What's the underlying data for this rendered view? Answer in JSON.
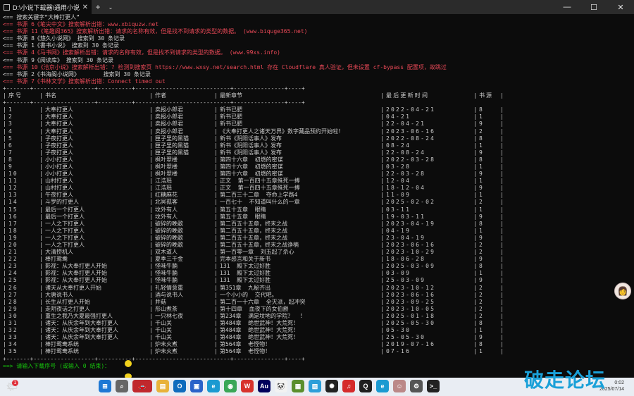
{
  "window": {
    "tab_title": "D:\\小说下载器\\通用小说下载器.exe",
    "tab_close": "✕",
    "new_tab": "+",
    "dropdown": "⌄",
    "minimize": "—",
    "maximize": "☐",
    "close": "✕"
  },
  "messages": [
    {
      "text": "<== 搜索关键字“大棒打更人”",
      "color": "white"
    },
    {
      "text": "<== 书源 6《笔尖中文》搜索解析出错：www.xbiquzw.net",
      "color": "red"
    },
    {
      "text": "<== 书源 11《笔趣阁365》搜索解析出错：请求的名称有效，但是找不到请求的类型的数据。 (www.biquge365.net)",
      "color": "red"
    },
    {
      "text": "<== 书源 8《悠久小说网》 搜索到 30 条记录",
      "color": "white"
    },
    {
      "text": "<== 书源 1《書书小说》 搜索到 30 条记录",
      "color": "white"
    },
    {
      "text": "<== 书源 4《马书网》搜索解析出错：请求的名称有效，但是找不到请求的类型的数据。 (www.99xs.info)",
      "color": "red"
    },
    {
      "text": "<== 书源 9《阅读库》 搜索到 30 条记录",
      "color": "white"
    },
    {
      "text": "<== 书源 10《洽京小说》搜索解析出错：? 检测到搜索页 https://www.wxsy.net/search.html 存在 Cloudflare 真人验证，但未设置 cf-bypass 配置项，故跳过",
      "color": "red"
    },
    {
      "text": "<== 书源 2《书海阁小说网》       搜索到 30 条记录",
      "color": "white"
    },
    {
      "text": "<== 书源 7《书林文学》搜索解析出错：Connect timed out",
      "color": "red"
    }
  ],
  "table": {
    "border": "+-------+------------------+----------+----------------------------+---------------+----+",
    "headers": [
      "序号",
      "书名",
      "作者",
      "最新章节",
      "最后更新时间",
      "书源"
    ],
    "rows": [
      [
        "1",
        "大奉打更人",
        "卖报小郎君",
        "新书已肥",
        "2022-04-21",
        "8"
      ],
      [
        "2",
        "大奉打更人",
        "卖报小郎君",
        "新书已肥",
        "04-21",
        "1"
      ],
      [
        "3",
        "大奉打更人",
        "卖报小郎君",
        "新书已肥",
        "22-04-21",
        "9"
      ],
      [
        "4",
        "大奉打更人",
        "卖报小郎君",
        "《大奉打更人之诸天万界》数字藏品预约开始啦！",
        "2023-06-16",
        "2"
      ],
      [
        "5",
        "子夜打更人",
        "匣子里的黑猫",
        "新书《阴阳话事人》发布",
        "2022-08-24",
        "8"
      ],
      [
        "6",
        "子夜打更人",
        "匣子里的黑猫",
        "新书《阴阳话事人》发布",
        "08-24",
        "1"
      ],
      [
        "7",
        "子夜打更人",
        "匣子里的黑猫",
        "新书《阴阳话事人》发布",
        "22-08-24",
        "9"
      ],
      [
        "8",
        "小小打更人",
        "枫叶翠楼",
        "第四十六章  初燃的密谋",
        "2022-03-28",
        "8"
      ],
      [
        "9",
        "小小打更人",
        "枫叶翠楼",
        "第四十六章  初燃的密谋",
        "03-28",
        "1"
      ],
      [
        "10",
        "小小打更人",
        "枫叶翠楼",
        "第四十六章  初燃的密谋",
        "22-03-28",
        "9"
      ],
      [
        "11",
        "山村打更人",
        "江浩瑶",
        "正文  第一百四十五章殊死一搏",
        "12-04",
        "1"
      ],
      [
        "12",
        "山村打更人",
        "江浩瑶",
        "正文  第一百四十五章殊死一搏",
        "18-12-04",
        "9"
      ],
      [
        "13",
        "午夜打更人",
        "红糖麻花",
        "第二百三十二章  夺命上学路4",
        "11-09",
        "1"
      ],
      [
        "14",
        "斗罗的打更人",
        "北冥孤客",
        "一百七十  不知道叫什么的一章",
        "2025-02-02",
        "2"
      ],
      [
        "15",
        "最后一个打更人",
        "坟外有人",
        "第五十五章  眼睛",
        "03-11",
        "1"
      ],
      [
        "16",
        "最后一个打更人",
        "坟外有人",
        "第五十五章  眼睛",
        "19-03-11",
        "9"
      ],
      [
        "17",
        "一人之下打更人",
        "破碎的晚歌",
        "第二百五十五章，终末之战",
        "2023-04-19",
        "8"
      ],
      [
        "18",
        "一人之下打更人",
        "破碎的晚歌",
        "第二百五十五章，终末之战",
        "04-19",
        "1"
      ],
      [
        "19",
        "一人之下打更人",
        "破碎的晚歌",
        "第二百五十五章，终末之战",
        "23-04-19",
        "9"
      ],
      [
        "20",
        "一人之下打更人",
        "破碎的晚歌",
        "第二百五十五章，终末之战诤楠",
        "2023-06-16",
        "2"
      ],
      [
        "21",
        "大清捞机人",
        "双木道人",
        "第一百零一章  刘玉起了杀心",
        "2023-10-29",
        "2"
      ],
      [
        "22",
        "棒打鸳鸯",
        "夏季三千金",
        "完本感言和关于新书",
        "18-06-28",
        "9"
      ],
      [
        "23",
        "影视：从大奉打更人开始",
        "怪味牛腩",
        "131  殿下太过好胜",
        "2025-03-09",
        "8"
      ],
      [
        "24",
        "影视：从大奉打更人开始",
        "怪味牛腩",
        "131  殿下太过好胜",
        "03-09",
        "1"
      ],
      [
        "25",
        "影视：从大奉打更人开始",
        "怪味牛腩",
        "131  殿下太过好胜",
        "25-03-09",
        "9"
      ],
      [
        "26",
        "诸天从大奉打更人开始",
        "礼轻情意重",
        "第351章  九秘齐出",
        "2023-10-12",
        "2"
      ],
      [
        "27",
        "大唐说书人",
        "酒与说书人",
        "一个小小的  交代吧。",
        "2023-06-16",
        "2"
      ],
      [
        "28",
        "长生从打更人开始",
        "井菇",
        "第二百一十六章  全灭派，起冲突",
        "2023-09-25",
        "2"
      ],
      [
        "29",
        "走阴夜话之打更人",
        "彤山煮茶",
        "第十四章  血夜下的女伯爵",
        "2023-10-05",
        "2"
      ],
      [
        "30",
        "重生之我乃大夏最强打更人",
        "一只林七夜",
        "第234章  满是坟地的学院？  ！",
        "2025-01-18",
        "2"
      ],
      [
        "31",
        "诸天：从庆余年到大奉打更人",
        "千山关",
        "第484章  绝世武神！大荒死！",
        "2025-05-30",
        "8"
      ],
      [
        "32",
        "诸天：从庆余年到大奉打更人",
        "千山关",
        "第484章  绝世武神！大荒死！",
        "05-30",
        "1"
      ],
      [
        "33",
        "诸天：从庆余年到大奉打更人",
        "千山关",
        "第484章  绝世武神！大荒死！",
        "25-05-30",
        "9"
      ],
      [
        "34",
        "棒打鸳鸯系统",
        "炉未火煮",
        "第564章  老怪物！",
        "2019-07-16",
        "8"
      ],
      [
        "35",
        "棒打鸳鸯系统",
        "炉未火煮",
        "第564章  老怪物！",
        "07-16",
        "1"
      ]
    ]
  },
  "prompt": "==> 请输入下载序号 (或输入 0 结束)：",
  "taskbar": {
    "notification_count": "1",
    "icons": [
      "windows-start",
      "search",
      "car-app",
      "file-explorer",
      "outlook",
      "store",
      "edge",
      "chrome",
      "wps",
      "audition",
      "panda",
      "app-tiles",
      "photo",
      "openai",
      "netease-music",
      "qq",
      "edge-2",
      "avatar-app",
      "settings",
      "terminal"
    ],
    "time": "0:02",
    "date": "2025/07/14"
  },
  "watermark": "破走论坛",
  "colors": {
    "background": "#0c0c0c",
    "error": "#e74856",
    "prompt": "#16c60c",
    "watermark": "#1aa0d8"
  }
}
